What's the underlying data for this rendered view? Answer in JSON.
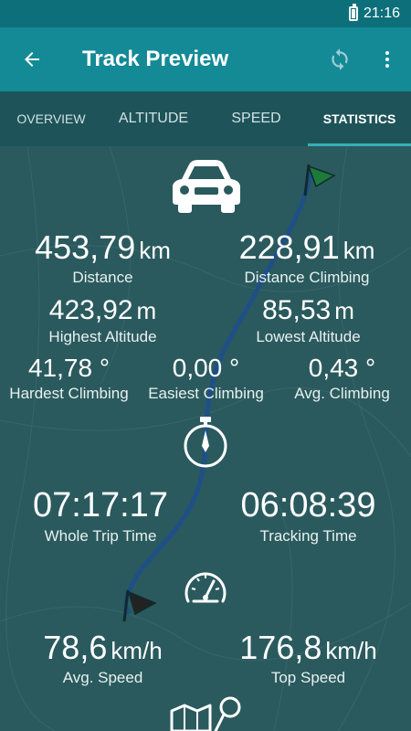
{
  "status": {
    "time": "21:16"
  },
  "header": {
    "title": "Track Preview"
  },
  "tabs": [
    {
      "label": "OVERVIEW"
    },
    {
      "label": "ALTITUDE"
    },
    {
      "label": "SPEED"
    },
    {
      "label": "STATISTICS"
    }
  ],
  "stats": {
    "distance": {
      "value": "453,79",
      "unit": "km",
      "label": "Distance"
    },
    "distance_climbing": {
      "value": "228,91",
      "unit": "km",
      "label": "Distance Climbing"
    },
    "highest_altitude": {
      "value": "423,92",
      "unit": "m",
      "label": "Highest Altitude"
    },
    "lowest_altitude": {
      "value": "85,53",
      "unit": "m",
      "label": "Lowest Altitude"
    },
    "hardest_climbing": {
      "value": "41,78 °",
      "label": "Hardest Climbing"
    },
    "easiest_climbing": {
      "value": "0,00 °",
      "label": "Easiest Climbing"
    },
    "avg_climbing": {
      "value": "0,43 °",
      "label": "Avg. Climbing"
    },
    "whole_trip_time": {
      "value": "07:17:17",
      "label": "Whole Trip Time"
    },
    "tracking_time": {
      "value": "06:08:39",
      "label": "Tracking Time"
    },
    "avg_speed": {
      "value": "78,6",
      "unit": "km/h",
      "label": "Avg. Speed"
    },
    "top_speed": {
      "value": "176,8",
      "unit": "km/h",
      "label": "Top Speed"
    }
  },
  "icons": {
    "back": "arrow-left-icon",
    "sync": "sync-icon",
    "more": "more-vert-icon",
    "vehicle": "car-icon",
    "stopwatch": "stopwatch-icon",
    "speedometer": "speedometer-icon",
    "map": "map-pin-icon"
  },
  "colors": {
    "status_bar": "#0d6f7a",
    "app_bar": "#138a96",
    "tabs_bg": "#1e5459",
    "tab_indicator": "#34b0ba",
    "content_bg": "#2a5a5e",
    "route": "#1f4f86"
  }
}
